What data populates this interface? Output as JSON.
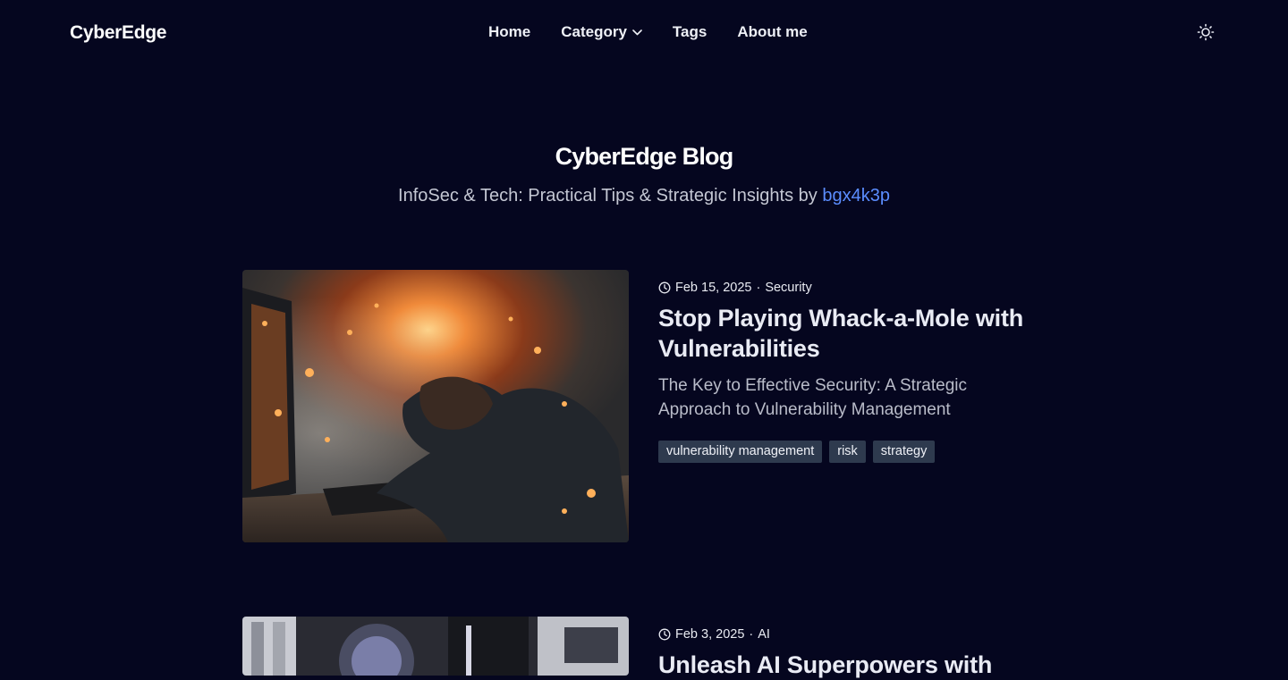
{
  "header": {
    "logo": "CyberEdge",
    "nav": [
      {
        "label": "Home"
      },
      {
        "label": "Category",
        "has_dropdown": true
      },
      {
        "label": "Tags"
      },
      {
        "label": "About me"
      }
    ],
    "theme_icon": "sun-icon"
  },
  "hero": {
    "title": "CyberEdge Blog",
    "subtitle_prefix": "InfoSec & Tech: Practical Tips & Strategic Insights by ",
    "author": "bgx4k3p"
  },
  "posts": [
    {
      "date": "Feb 15, 2025",
      "separator": "·",
      "category": "Security",
      "title": "Stop Playing Whack-a-Mole with Vulnerabilities",
      "description": "The Key to Effective Security: A Strategic Approach to Vulnerability Management",
      "tags": [
        "vulnerability management",
        "risk",
        "strategy"
      ]
    },
    {
      "date": "Feb 3, 2025",
      "separator": "·",
      "category": "AI",
      "title": "Unleash AI Superpowers with"
    }
  ],
  "colors": {
    "background": "#05061f",
    "accent_link": "#5b8dff",
    "tag_background": "#2e3a4e",
    "muted_text": "#b9bcc9"
  }
}
